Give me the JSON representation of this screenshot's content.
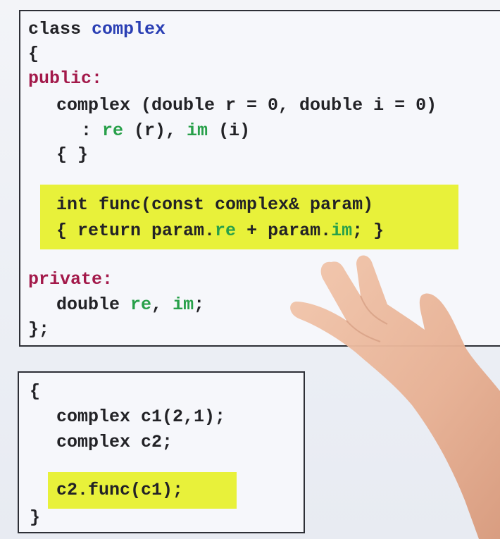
{
  "class_box": {
    "line1": {
      "kw": "class",
      "name": "complex"
    },
    "line2": "{",
    "line3": "public:",
    "line4": "complex (double r = 0, double i = 0)",
    "line5": {
      "prefix": ": ",
      "re": "re",
      "mid": " (r), ",
      "im": "im",
      "suffix": " (i)"
    },
    "line6": "{ }",
    "func_line1": "int func(const complex& param)",
    "func_line2": {
      "a": "{ return param.",
      "re": "re",
      "b": " + param.",
      "im": "im",
      "c": "; }"
    },
    "line_private": "private:",
    "line_member": {
      "a": "double ",
      "re": "re",
      "b": ", ",
      "im": "im",
      "c": ";"
    },
    "line_end": "};"
  },
  "main_box": {
    "open": "{",
    "decl1": "complex c1(2,1);",
    "decl2": "complex c2;",
    "call": "c2.func(c1);",
    "close": "}"
  },
  "colors": {
    "keyword_blue": "#2a3fb4",
    "keyword_red": "#a3194a",
    "member_green": "#28a04a",
    "highlight": "#e8f13a"
  }
}
